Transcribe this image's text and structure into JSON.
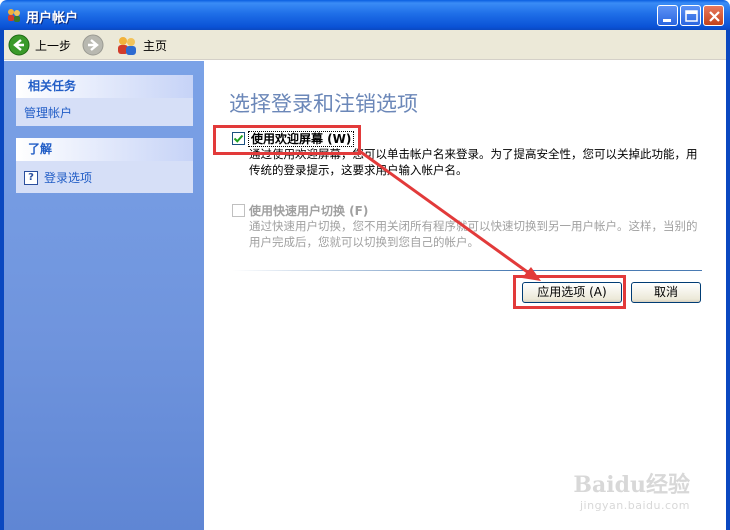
{
  "window": {
    "title": "用户帐户"
  },
  "toolbar": {
    "back_label": "上一步",
    "home_label": "主页"
  },
  "sidebar": {
    "tasks_title": "相关任务",
    "tasks_link": "管理帐户",
    "learn_title": "了解",
    "learn_link": "登录选项"
  },
  "main": {
    "title": "选择登录和注销选项",
    "options": [
      {
        "label": "使用欢迎屏幕 (W)",
        "checked": true,
        "enabled": true,
        "description": "通过使用欢迎屏幕，您可以单击帐户名来登录。为了提高安全性，您可以关掉此功能，用传统的登录提示，这要求用户输入帐户名。"
      },
      {
        "label": "使用快速用户切换 (F)",
        "checked": false,
        "enabled": false,
        "description": "通过快速用户切换，您不用关闭所有程序就可以快速切换到另一用户帐户。这样，当别的用户完成后，您就可以切换到您自己的帐户。"
      }
    ],
    "apply_button": "应用选项 (A)",
    "cancel_button": "取消"
  },
  "watermark": {
    "logo": "Baidu经验",
    "url": "jingyan.baidu.com"
  },
  "colors": {
    "titlebar": "#0a52d6",
    "sidebar": "#6f94dd",
    "heading": "#6b87b8",
    "annotation": "#e23a3a"
  }
}
